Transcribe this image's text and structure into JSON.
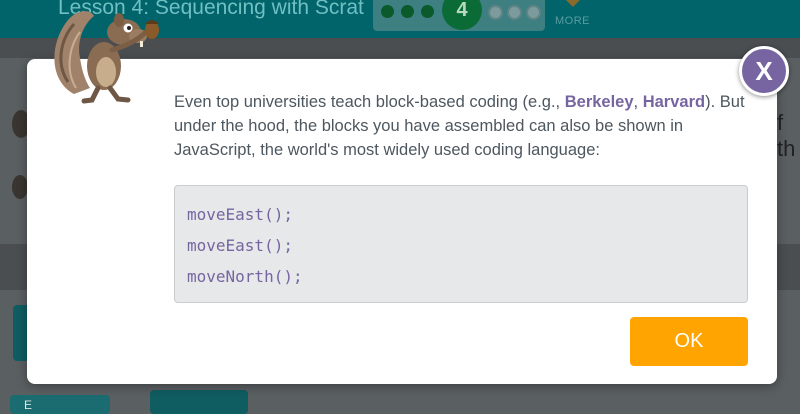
{
  "header": {
    "lesson_title": "Lesson 4: Sequencing with Scrat",
    "current_level": "4",
    "more_label": "MORE"
  },
  "background": {
    "partial_text": "f th",
    "partial_small": "E"
  },
  "dialog": {
    "text": {
      "part1": "Even top universities teach block-based coding (e.g., ",
      "link1": "Berkeley",
      "sep": ", ",
      "link2": "Harvard",
      "part2": "). But under the hood, the blocks you have assembled can also be shown in JavaScript, the world's most widely used coding language:"
    },
    "code": [
      "moveEast();",
      "moveEast();",
      "moveNorth();"
    ],
    "ok_label": "OK",
    "close_label": "X"
  },
  "icons": {
    "character": "scrat-squirrel-icon",
    "close": "close-icon"
  },
  "colors": {
    "header_bg": "#00646a",
    "accent_purple": "#7665a0",
    "ok_orange": "#ffa400",
    "text_gray": "#4d575f",
    "code_bg": "#e7e8ea"
  }
}
